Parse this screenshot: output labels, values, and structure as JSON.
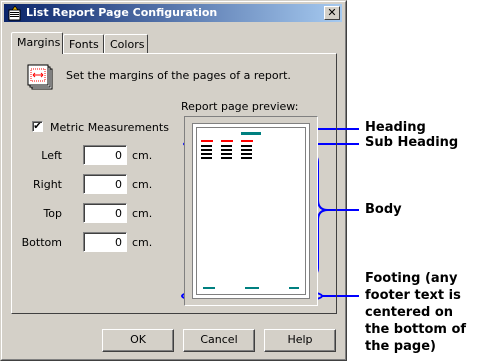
{
  "window": {
    "title": "List Report Page Configuration",
    "close_symbol": "✕"
  },
  "tabs": [
    {
      "label": "Margins",
      "active": true
    },
    {
      "label": "Fonts",
      "active": false
    },
    {
      "label": "Colors",
      "active": false
    }
  ],
  "margins_panel": {
    "description": "Set the margins of the pages of a report.",
    "metric": {
      "label": "Metric Measurements",
      "checked": true,
      "check_glyph": "✔"
    },
    "fields": [
      {
        "label": "Left",
        "value": "0",
        "unit": "cm."
      },
      {
        "label": "Right",
        "value": "0",
        "unit": "cm."
      },
      {
        "label": "Top",
        "value": "0",
        "unit": "cm."
      },
      {
        "label": "Bottom",
        "value": "0",
        "unit": "cm."
      }
    ],
    "preview_label": "Report page preview:"
  },
  "buttons": {
    "ok": "OK",
    "cancel": "Cancel",
    "help": "Help"
  },
  "annotations": {
    "heading": "Heading",
    "sub_heading": "Sub Heading",
    "body": "Body",
    "footing_lines": [
      "Footing (any",
      "footer text is",
      "centered on",
      "the bottom of",
      "the page)"
    ]
  },
  "colors": {
    "titlebar_start": "#0a246a",
    "dialog_bg": "#d4d0c8",
    "annotation_blue": "#0000ff",
    "preview_heading": "#008080",
    "preview_subheading": "#ff0000"
  },
  "icons": {
    "title": "app-icon",
    "pages": "pages-icon",
    "close": "close-icon",
    "check": "check-icon"
  }
}
